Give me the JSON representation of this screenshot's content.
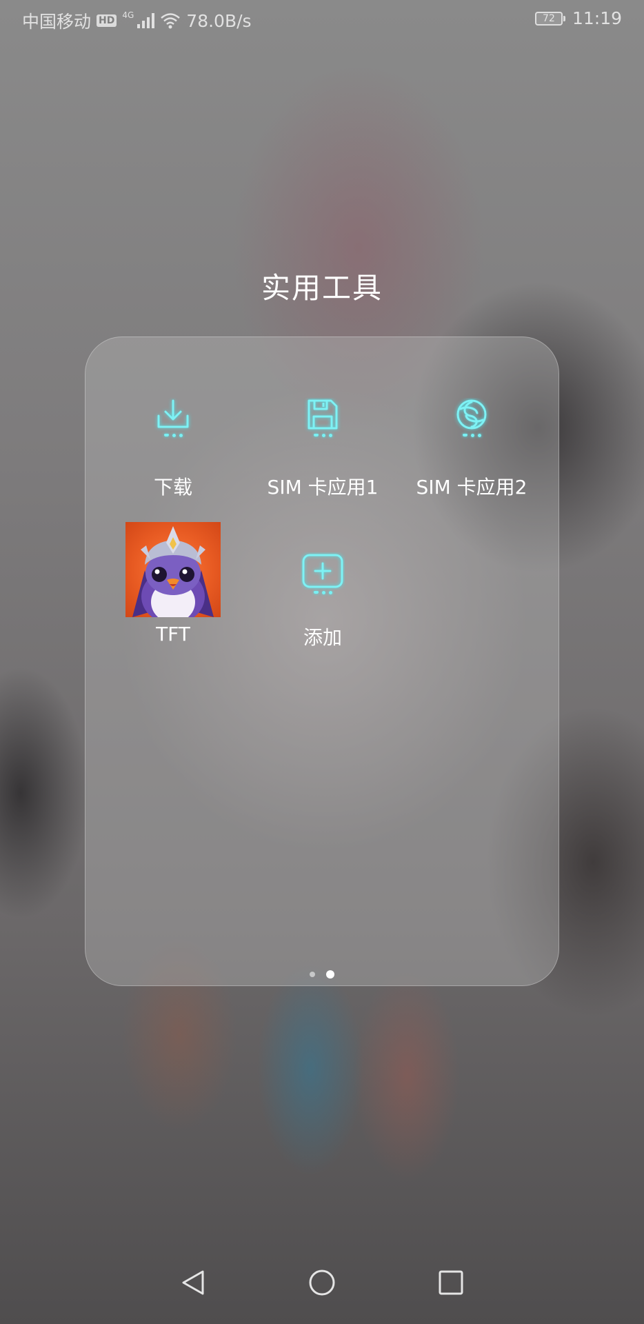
{
  "status_bar": {
    "carrier": "中国移动",
    "hd_badge": "HD",
    "network_type": "4G",
    "net_speed": "78.0B/s",
    "battery_level": "72",
    "time": "11:19",
    "icons": [
      "signal-icon",
      "wifi-icon",
      "battery-icon"
    ]
  },
  "folder": {
    "title": "实用工具",
    "apps": [
      {
        "label": "下载",
        "icon": "download-icon"
      },
      {
        "label": "SIM 卡应用1",
        "icon": "sim-card-floppy-icon"
      },
      {
        "label": "SIM 卡应用2",
        "icon": "sim-card-swirl-icon"
      },
      {
        "label": "TFT",
        "icon": "tft-app-icon"
      },
      {
        "label": "添加",
        "icon": "add-icon"
      }
    ],
    "page_indicator": {
      "pages": 2,
      "current": 2
    }
  },
  "nav_bar": {
    "buttons": [
      "back-icon",
      "home-icon",
      "recents-icon"
    ]
  },
  "colors": {
    "accent_glow": "#79f0f3",
    "tft_background": "#e75a22"
  }
}
